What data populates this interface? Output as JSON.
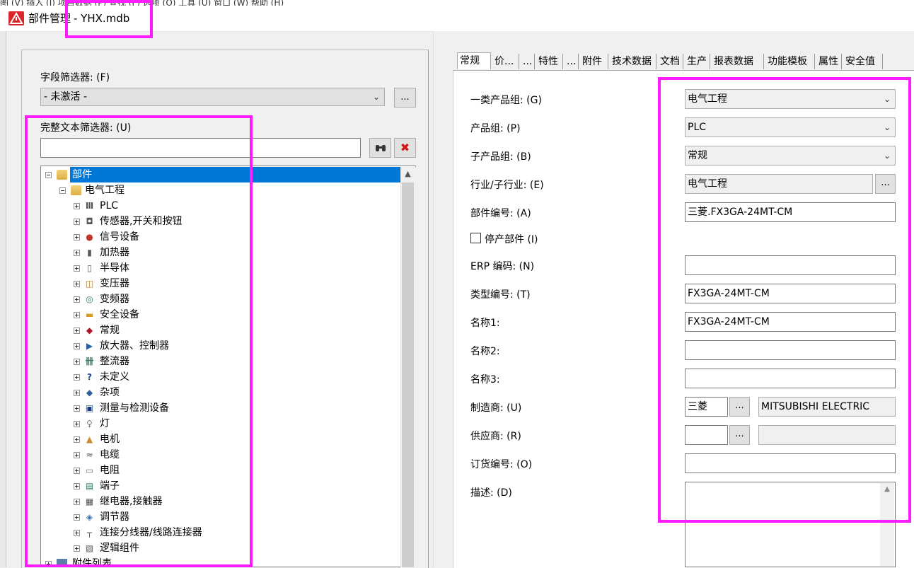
{
  "menu_remnant": "图 (V)   插入 (I)   项目数据 (P)   查找 (F)   选项 (O)   工具 (U)   窗口 (W)   帮助 (H)",
  "window": {
    "title": "部件管理",
    "file": "- YHX.mdb"
  },
  "left": {
    "field_filter_label": "字段筛选器: (F)",
    "field_filter_value": "- 未激活 -",
    "field_filter_button": "...",
    "fulltext_label": "完整文本筛选器: (U)",
    "fulltext_value": "",
    "search_icon": "binoculars-icon",
    "clear_icon": "red-x-icon"
  },
  "tree": {
    "root": "部件",
    "group": "电气工程",
    "items": [
      {
        "label": "PLC",
        "icon": "plc-icon"
      },
      {
        "label": "传感器,开关和按钮",
        "icon": "sensor-icon"
      },
      {
        "label": "信号设备",
        "icon": "signal-icon"
      },
      {
        "label": "加热器",
        "icon": "heater-icon"
      },
      {
        "label": "半导体",
        "icon": "semiconductor-icon"
      },
      {
        "label": "变压器",
        "icon": "transformer-icon"
      },
      {
        "label": "变频器",
        "icon": "inverter-icon"
      },
      {
        "label": "安全设备",
        "icon": "safety-icon"
      },
      {
        "label": "常规",
        "icon": "general-icon"
      },
      {
        "label": "放大器、控制器",
        "icon": "amplifier-icon"
      },
      {
        "label": "整流器",
        "icon": "rectifier-icon"
      },
      {
        "label": "未定义",
        "icon": "question-icon"
      },
      {
        "label": "杂项",
        "icon": "misc-icon"
      },
      {
        "label": "测量与检测设备",
        "icon": "meter-icon"
      },
      {
        "label": "灯",
        "icon": "lamp-icon"
      },
      {
        "label": "电机",
        "icon": "motor-icon"
      },
      {
        "label": "电缆",
        "icon": "cable-icon"
      },
      {
        "label": "电阻",
        "icon": "resistor-icon"
      },
      {
        "label": "端子",
        "icon": "terminal-icon"
      },
      {
        "label": "继电器,接触器",
        "icon": "relay-icon"
      },
      {
        "label": "调节器",
        "icon": "regulator-icon"
      },
      {
        "label": "连接分线器/线路连接器",
        "icon": "connector-icon"
      },
      {
        "label": "逻辑组件",
        "icon": "logic-icon"
      }
    ],
    "next_root": "附件列表"
  },
  "tabs": [
    "常规",
    "价...",
    "...",
    "特性",
    "...",
    "附件",
    "技术数据",
    "文档",
    "生产",
    "报表数据",
    "功能模板",
    "属性",
    "安全值"
  ],
  "form": {
    "product_group1": {
      "label": "一类产品组: (G)",
      "value": "电气工程"
    },
    "product_group": {
      "label": "产品组: (P)",
      "value": "PLC"
    },
    "sub_group": {
      "label": "子产品组: (B)",
      "value": "常规"
    },
    "industry": {
      "label": "行业/子行业: (E)",
      "value": "电气工程",
      "button": "..."
    },
    "part_number": {
      "label": "部件编号: (A)",
      "value": "三菱.FX3GA-24MT-CM"
    },
    "discontinued": {
      "label": "停产部件 (I)",
      "checked": false
    },
    "erp": {
      "label": "ERP 编码: (N)",
      "value": ""
    },
    "type_number": {
      "label": "类型编号: (T)",
      "value": "FX3GA-24MT-CM"
    },
    "name1": {
      "label": "名称1:",
      "value": "FX3GA-24MT-CM"
    },
    "name2": {
      "label": "名称2:",
      "value": ""
    },
    "name3": {
      "label": "名称3:",
      "value": ""
    },
    "manufacturer": {
      "label": "制造商: (U)",
      "code": "三菱",
      "button": "...",
      "name": "MITSUBISHI ELECTRIC"
    },
    "supplier": {
      "label": "供应商: (R)",
      "code": "",
      "button": "...",
      "name": ""
    },
    "order_number": {
      "label": "订货编号: (O)",
      "value": ""
    },
    "description": {
      "label": "描述: (D)",
      "value": ""
    }
  },
  "colors": {
    "highlight": "#ff1cff",
    "selection": "#0078d7"
  }
}
